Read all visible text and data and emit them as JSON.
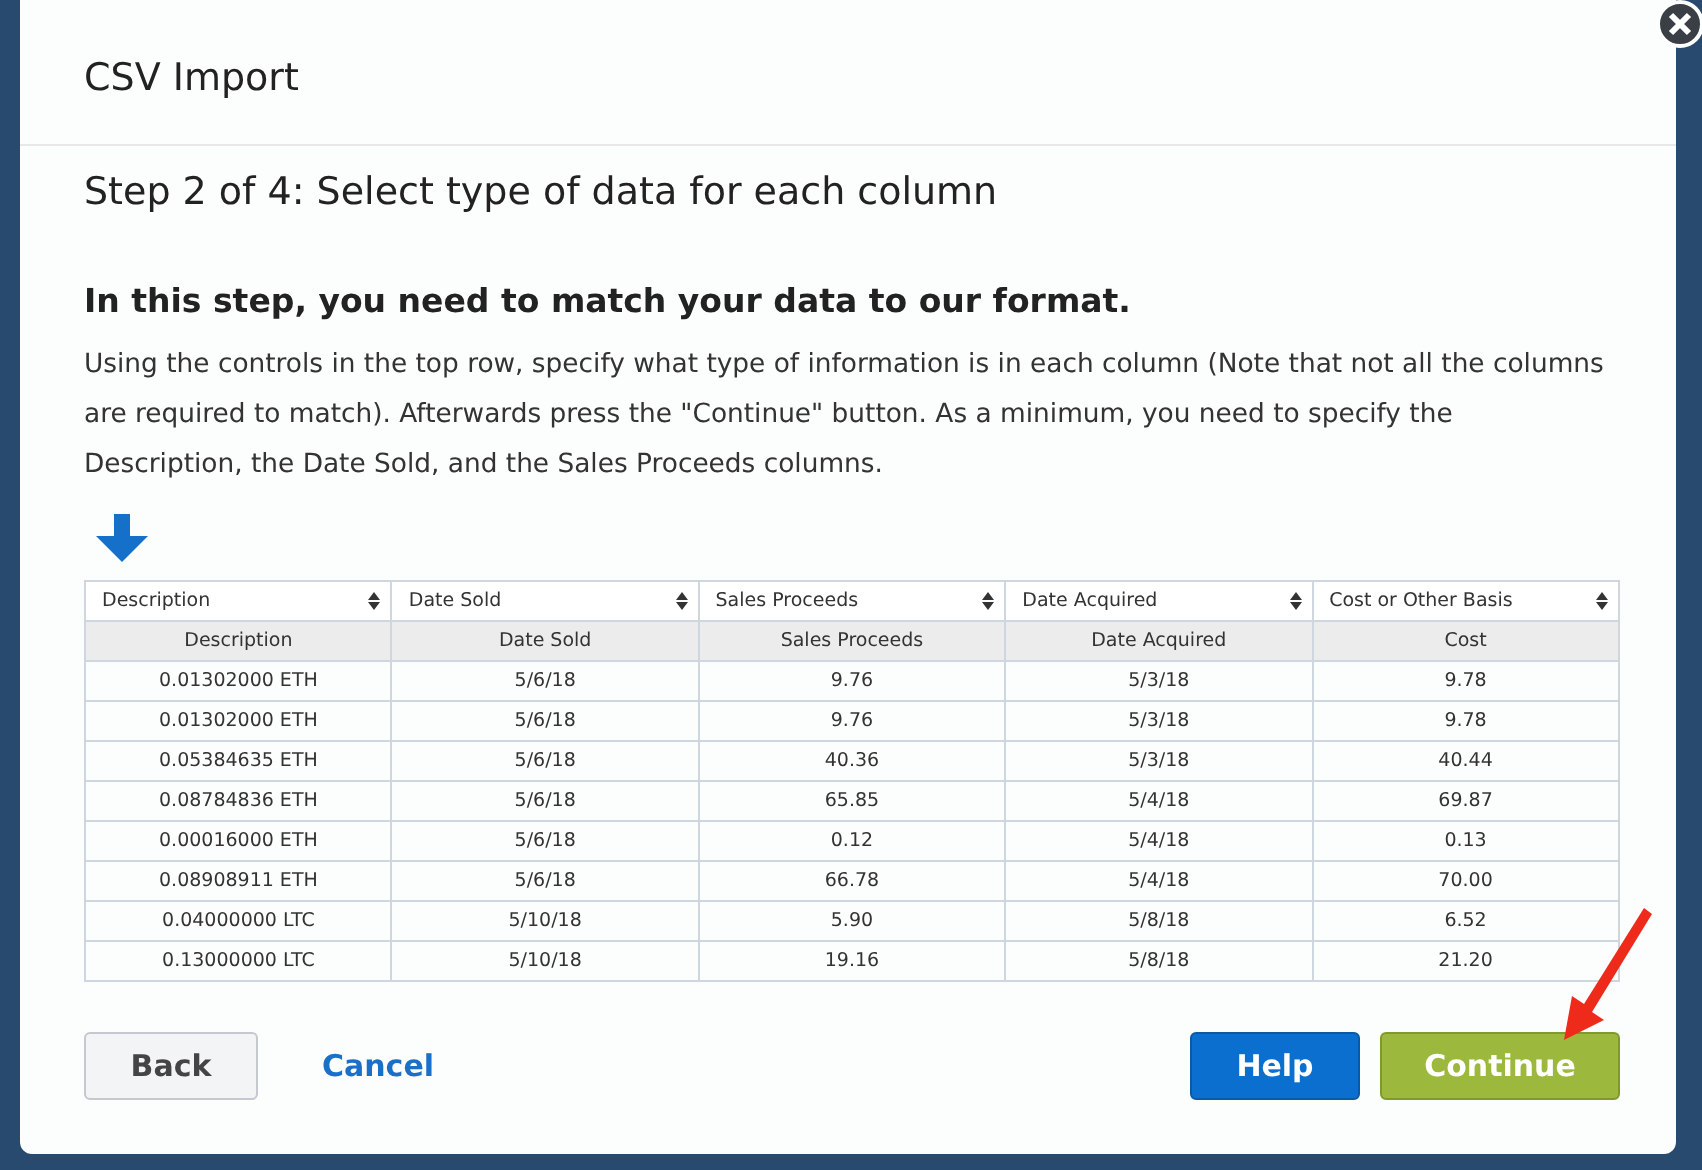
{
  "dialog": {
    "title": "CSV Import",
    "step": "Step 2 of 4: Select type of data for each column",
    "heading": "In this step, you need to match your data to our format.",
    "instructions": "Using the controls in the top row, specify what type of information is in each column (Note that not all the columns are required to match). Afterwards press the \"Continue\" button. As a minimum, you need to specify the Description, the Date Sold, and the Sales Proceeds columns."
  },
  "table": {
    "selectors": [
      "Description",
      "Date Sold",
      "Sales Proceeds",
      "Date Acquired",
      "Cost or Other Basis"
    ],
    "columns": [
      "Description",
      "Date Sold",
      "Sales Proceeds",
      "Date Acquired",
      "Cost"
    ],
    "rows": [
      [
        "0.01302000 ETH",
        "5/6/18",
        "9.76",
        "5/3/18",
        "9.78"
      ],
      [
        "0.01302000 ETH",
        "5/6/18",
        "9.76",
        "5/3/18",
        "9.78"
      ],
      [
        "0.05384635 ETH",
        "5/6/18",
        "40.36",
        "5/3/18",
        "40.44"
      ],
      [
        "0.08784836 ETH",
        "5/6/18",
        "65.85",
        "5/4/18",
        "69.87"
      ],
      [
        "0.00016000 ETH",
        "5/6/18",
        "0.12",
        "5/4/18",
        "0.13"
      ],
      [
        "0.08908911 ETH",
        "5/6/18",
        "66.78",
        "5/4/18",
        "70.00"
      ],
      [
        "0.04000000 LTC",
        "5/10/18",
        "5.90",
        "5/8/18",
        "6.52"
      ],
      [
        "0.13000000 LTC",
        "5/10/18",
        "19.16",
        "5/8/18",
        "21.20"
      ]
    ]
  },
  "buttons": [
    {
      "label": "Back",
      "kind": "secondary"
    },
    {
      "label": "Cancel",
      "kind": "link"
    },
    {
      "label": "Help",
      "kind": "help"
    },
    {
      "label": "Continue",
      "kind": "primary"
    }
  ]
}
